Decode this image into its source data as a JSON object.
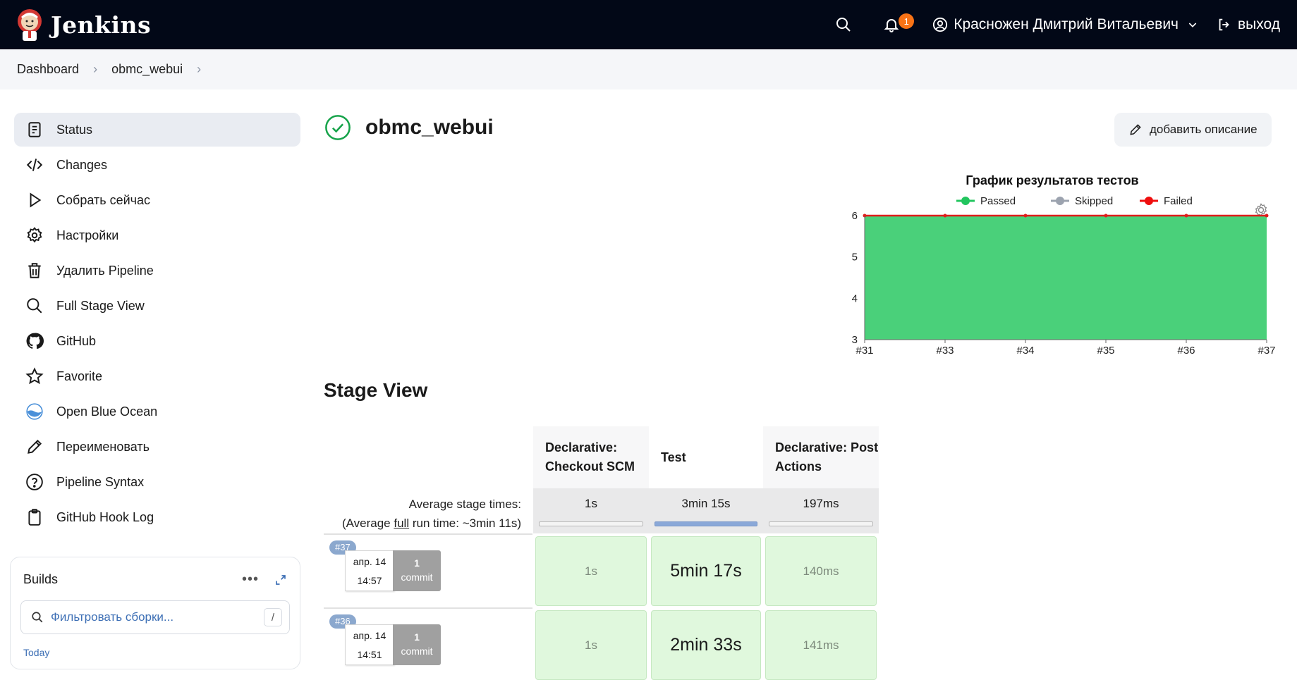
{
  "topbar": {
    "brand": "Jenkins",
    "notifications_count": "1",
    "user_name": "Красножен Дмитрий Витальевич",
    "logout_label": "выход"
  },
  "breadcrumb": [
    "Dashboard",
    "obmc_webui"
  ],
  "sidebar": {
    "items": [
      {
        "label": "Status",
        "icon": "status-icon"
      },
      {
        "label": "Changes",
        "icon": "code-icon"
      },
      {
        "label": "Собрать сейчас",
        "icon": "play-icon"
      },
      {
        "label": "Настройки",
        "icon": "gear-icon"
      },
      {
        "label": "Удалить Pipeline",
        "icon": "trash-icon"
      },
      {
        "label": "Full Stage View",
        "icon": "search-icon"
      },
      {
        "label": "GitHub",
        "icon": "github-icon"
      },
      {
        "label": "Favorite",
        "icon": "star-icon"
      },
      {
        "label": "Open Blue Ocean",
        "icon": "blue-ocean-icon"
      },
      {
        "label": "Переименовать",
        "icon": "pencil-icon"
      },
      {
        "label": "Pipeline Syntax",
        "icon": "help-icon"
      },
      {
        "label": "GitHub Hook Log",
        "icon": "clipboard-icon"
      }
    ]
  },
  "builds": {
    "title": "Builds",
    "filter_placeholder": "Фильтровать сборки...",
    "shortcut": "/",
    "group": "Today"
  },
  "page": {
    "title": "obmc_webui",
    "add_description": "добавить описание"
  },
  "chart_data": {
    "type": "area",
    "title": "График результатов тестов",
    "legend": [
      "Passed",
      "Skipped",
      "Failed"
    ],
    "categories": [
      "#31",
      "#33",
      "#34",
      "#35",
      "#36",
      "#37"
    ],
    "series": [
      {
        "name": "Passed",
        "values": [
          6,
          6,
          6,
          6,
          6,
          6
        ],
        "color": "#22c55e"
      },
      {
        "name": "Skipped",
        "values": [
          0,
          0,
          0,
          0,
          0,
          0
        ],
        "color": "#9ca3af"
      },
      {
        "name": "Failed",
        "values": [
          0,
          0,
          0,
          0,
          0,
          0
        ],
        "color": "#ef0e0e"
      }
    ],
    "yticks": [
      "3",
      "4",
      "5",
      "6"
    ],
    "ylim": [
      3,
      6
    ],
    "legend_position": "top"
  },
  "stage_view": {
    "title": "Stage View",
    "stages": [
      "Declarative: Checkout SCM",
      "Test",
      "Declarative: Post Actions"
    ],
    "avg_label": "Average stage times:",
    "avg_run_prefix": "(Average ",
    "avg_run_link": "full",
    "avg_run_suffix": " run time: ~3min 11s)",
    "avg_times": [
      "1s",
      "3min 15s",
      "197ms"
    ],
    "runs": [
      {
        "num": "#37",
        "date": "апр. 14",
        "time": "14:57",
        "commits": "1",
        "commit_label": "commit",
        "durations": [
          "1s",
          "5min 17s",
          "140ms"
        ]
      },
      {
        "num": "#36",
        "date": "апр. 14",
        "time": "14:51",
        "commits": "1",
        "commit_label": "commit",
        "durations": [
          "1s",
          "2min 33s",
          "141ms"
        ]
      }
    ]
  }
}
